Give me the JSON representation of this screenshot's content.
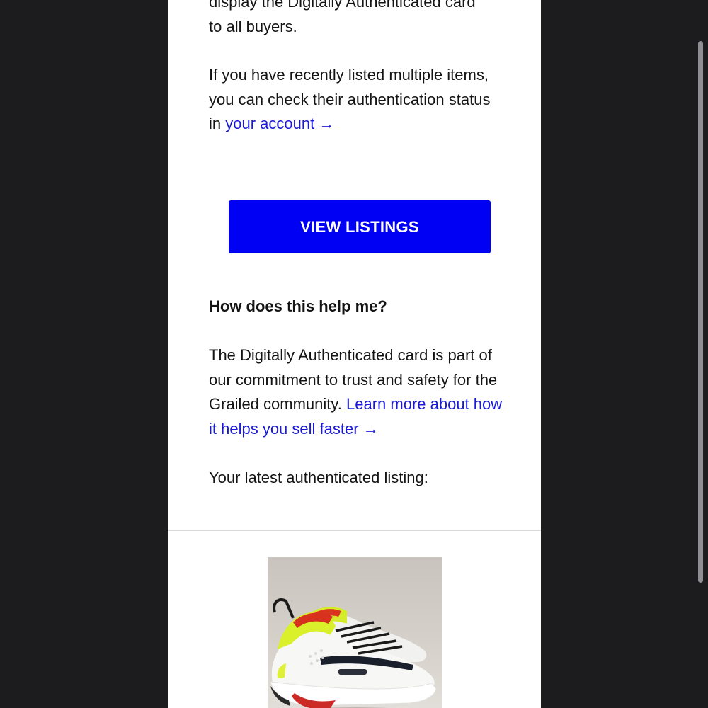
{
  "email": {
    "paragraph_top": {
      "line1": "display the Digitally Authenticated card",
      "line2": "to all buyers."
    },
    "paragraph_multiple": {
      "text": "If you have recently listed multiple items, you can check their authentication status in",
      "link": "your account →"
    },
    "cta_button": "VIEW LISTINGS",
    "help_heading": "How does this help me?",
    "paragraph_help": {
      "text": "The Digitally Authenticated card is part of our commitment to trust and safety for the Grailed community.",
      "link": "Learn more about how it helps you sell faster →"
    },
    "latest_listing_label": "Your latest authenticated listing:"
  },
  "listing": {
    "image_icon": "sneaker-photo"
  },
  "colors": {
    "background": "#1c1c1e",
    "link": "#1a1ad6",
    "button": "#0000f5",
    "text": "#141414"
  }
}
